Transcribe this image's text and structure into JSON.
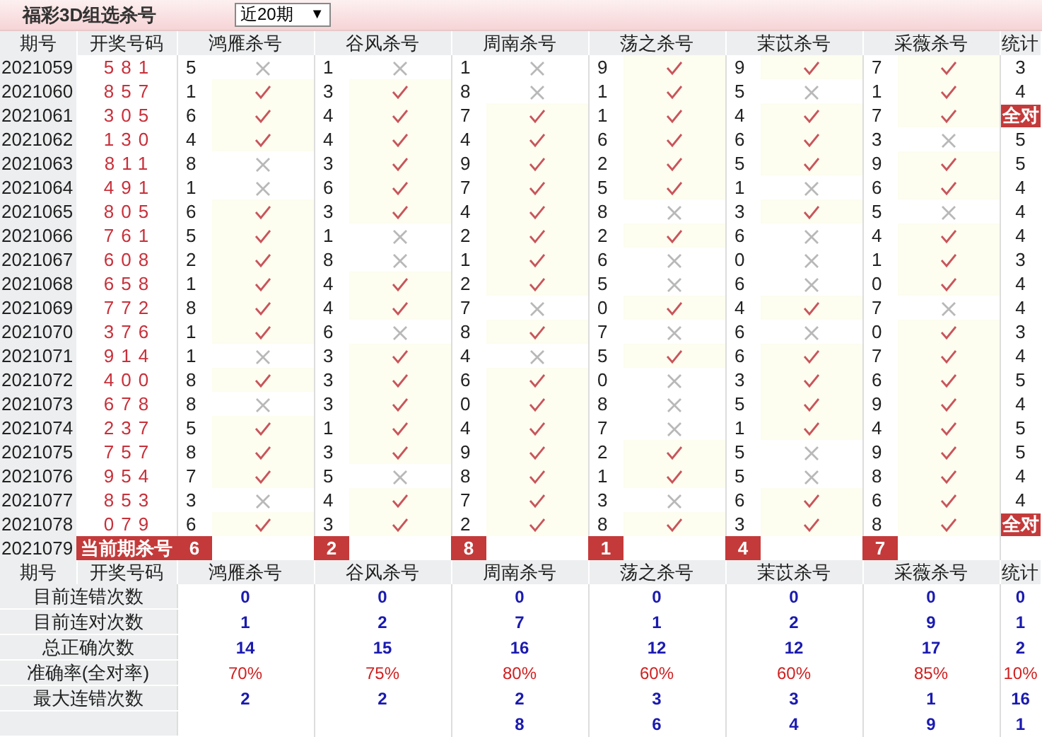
{
  "title": "福彩3D组选杀号",
  "range_select": {
    "value": "近20期",
    "arrow": "▼"
  },
  "columns": [
    "期号",
    "开奖号码",
    "鸿雁杀号",
    "谷风杀号",
    "周南杀号",
    "荡之杀号",
    "茉苡杀号",
    "采薇杀号",
    "统计"
  ],
  "rows": [
    {
      "period": "2021059",
      "draw": "581",
      "kills": [
        {
          "number": "5",
          "hit": false
        },
        {
          "number": "1",
          "hit": false
        },
        {
          "number": "1",
          "hit": false
        },
        {
          "number": "9",
          "hit": true
        },
        {
          "number": "9",
          "hit": true
        },
        {
          "number": "7",
          "hit": true
        }
      ],
      "stat": "3",
      "all_correct": false
    },
    {
      "period": "2021060",
      "draw": "857",
      "kills": [
        {
          "number": "1",
          "hit": true
        },
        {
          "number": "3",
          "hit": true
        },
        {
          "number": "8",
          "hit": false
        },
        {
          "number": "1",
          "hit": true
        },
        {
          "number": "5",
          "hit": false
        },
        {
          "number": "1",
          "hit": true
        }
      ],
      "stat": "4",
      "all_correct": false
    },
    {
      "period": "2021061",
      "draw": "305",
      "kills": [
        {
          "number": "6",
          "hit": true
        },
        {
          "number": "4",
          "hit": true
        },
        {
          "number": "7",
          "hit": true
        },
        {
          "number": "1",
          "hit": true
        },
        {
          "number": "4",
          "hit": true
        },
        {
          "number": "7",
          "hit": true
        }
      ],
      "stat": "全对",
      "all_correct": true
    },
    {
      "period": "2021062",
      "draw": "130",
      "kills": [
        {
          "number": "4",
          "hit": true
        },
        {
          "number": "4",
          "hit": true
        },
        {
          "number": "4",
          "hit": true
        },
        {
          "number": "6",
          "hit": true
        },
        {
          "number": "6",
          "hit": true
        },
        {
          "number": "3",
          "hit": false
        }
      ],
      "stat": "5",
      "all_correct": false
    },
    {
      "period": "2021063",
      "draw": "811",
      "kills": [
        {
          "number": "8",
          "hit": false
        },
        {
          "number": "3",
          "hit": true
        },
        {
          "number": "9",
          "hit": true
        },
        {
          "number": "2",
          "hit": true
        },
        {
          "number": "5",
          "hit": true
        },
        {
          "number": "9",
          "hit": true
        }
      ],
      "stat": "5",
      "all_correct": false
    },
    {
      "period": "2021064",
      "draw": "491",
      "kills": [
        {
          "number": "1",
          "hit": false
        },
        {
          "number": "6",
          "hit": true
        },
        {
          "number": "7",
          "hit": true
        },
        {
          "number": "5",
          "hit": true
        },
        {
          "number": "1",
          "hit": false
        },
        {
          "number": "6",
          "hit": true
        }
      ],
      "stat": "4",
      "all_correct": false
    },
    {
      "period": "2021065",
      "draw": "805",
      "kills": [
        {
          "number": "6",
          "hit": true
        },
        {
          "number": "3",
          "hit": true
        },
        {
          "number": "4",
          "hit": true
        },
        {
          "number": "8",
          "hit": false
        },
        {
          "number": "3",
          "hit": true
        },
        {
          "number": "5",
          "hit": false
        }
      ],
      "stat": "4",
      "all_correct": false
    },
    {
      "period": "2021066",
      "draw": "761",
      "kills": [
        {
          "number": "5",
          "hit": true
        },
        {
          "number": "1",
          "hit": false
        },
        {
          "number": "2",
          "hit": true
        },
        {
          "number": "2",
          "hit": true
        },
        {
          "number": "6",
          "hit": false
        },
        {
          "number": "4",
          "hit": true
        }
      ],
      "stat": "4",
      "all_correct": false
    },
    {
      "period": "2021067",
      "draw": "608",
      "kills": [
        {
          "number": "2",
          "hit": true
        },
        {
          "number": "8",
          "hit": false
        },
        {
          "number": "1",
          "hit": true
        },
        {
          "number": "6",
          "hit": false
        },
        {
          "number": "0",
          "hit": false
        },
        {
          "number": "1",
          "hit": true
        }
      ],
      "stat": "3",
      "all_correct": false
    },
    {
      "period": "2021068",
      "draw": "658",
      "kills": [
        {
          "number": "1",
          "hit": true
        },
        {
          "number": "4",
          "hit": true
        },
        {
          "number": "2",
          "hit": true
        },
        {
          "number": "5",
          "hit": false
        },
        {
          "number": "6",
          "hit": false
        },
        {
          "number": "0",
          "hit": true
        }
      ],
      "stat": "4",
      "all_correct": false
    },
    {
      "period": "2021069",
      "draw": "772",
      "kills": [
        {
          "number": "8",
          "hit": true
        },
        {
          "number": "4",
          "hit": true
        },
        {
          "number": "7",
          "hit": false
        },
        {
          "number": "0",
          "hit": true
        },
        {
          "number": "4",
          "hit": true
        },
        {
          "number": "7",
          "hit": false
        }
      ],
      "stat": "4",
      "all_correct": false
    },
    {
      "period": "2021070",
      "draw": "376",
      "kills": [
        {
          "number": "1",
          "hit": true
        },
        {
          "number": "6",
          "hit": false
        },
        {
          "number": "8",
          "hit": true
        },
        {
          "number": "7",
          "hit": false
        },
        {
          "number": "6",
          "hit": false
        },
        {
          "number": "0",
          "hit": true
        }
      ],
      "stat": "3",
      "all_correct": false
    },
    {
      "period": "2021071",
      "draw": "914",
      "kills": [
        {
          "number": "1",
          "hit": false
        },
        {
          "number": "3",
          "hit": true
        },
        {
          "number": "4",
          "hit": false
        },
        {
          "number": "5",
          "hit": true
        },
        {
          "number": "6",
          "hit": true
        },
        {
          "number": "7",
          "hit": true
        }
      ],
      "stat": "4",
      "all_correct": false
    },
    {
      "period": "2021072",
      "draw": "400",
      "kills": [
        {
          "number": "8",
          "hit": true
        },
        {
          "number": "3",
          "hit": true
        },
        {
          "number": "6",
          "hit": true
        },
        {
          "number": "0",
          "hit": false
        },
        {
          "number": "3",
          "hit": true
        },
        {
          "number": "6",
          "hit": true
        }
      ],
      "stat": "5",
      "all_correct": false
    },
    {
      "period": "2021073",
      "draw": "678",
      "kills": [
        {
          "number": "8",
          "hit": false
        },
        {
          "number": "3",
          "hit": true
        },
        {
          "number": "0",
          "hit": true
        },
        {
          "number": "8",
          "hit": false
        },
        {
          "number": "5",
          "hit": true
        },
        {
          "number": "9",
          "hit": true
        }
      ],
      "stat": "4",
      "all_correct": false
    },
    {
      "period": "2021074",
      "draw": "237",
      "kills": [
        {
          "number": "5",
          "hit": true
        },
        {
          "number": "1",
          "hit": true
        },
        {
          "number": "4",
          "hit": true
        },
        {
          "number": "7",
          "hit": false
        },
        {
          "number": "1",
          "hit": true
        },
        {
          "number": "4",
          "hit": true
        }
      ],
      "stat": "5",
      "all_correct": false
    },
    {
      "period": "2021075",
      "draw": "757",
      "kills": [
        {
          "number": "8",
          "hit": true
        },
        {
          "number": "3",
          "hit": true
        },
        {
          "number": "9",
          "hit": true
        },
        {
          "number": "2",
          "hit": true
        },
        {
          "number": "5",
          "hit": false
        },
        {
          "number": "9",
          "hit": true
        }
      ],
      "stat": "5",
      "all_correct": false
    },
    {
      "period": "2021076",
      "draw": "954",
      "kills": [
        {
          "number": "7",
          "hit": true
        },
        {
          "number": "5",
          "hit": false
        },
        {
          "number": "8",
          "hit": true
        },
        {
          "number": "1",
          "hit": true
        },
        {
          "number": "5",
          "hit": false
        },
        {
          "number": "8",
          "hit": true
        }
      ],
      "stat": "4",
      "all_correct": false
    },
    {
      "period": "2021077",
      "draw": "853",
      "kills": [
        {
          "number": "3",
          "hit": false
        },
        {
          "number": "4",
          "hit": true
        },
        {
          "number": "7",
          "hit": true
        },
        {
          "number": "3",
          "hit": false
        },
        {
          "number": "6",
          "hit": true
        },
        {
          "number": "6",
          "hit": true
        }
      ],
      "stat": "4",
      "all_correct": false
    },
    {
      "period": "2021078",
      "draw": "079",
      "kills": [
        {
          "number": "6",
          "hit": true
        },
        {
          "number": "3",
          "hit": true
        },
        {
          "number": "2",
          "hit": true
        },
        {
          "number": "8",
          "hit": true
        },
        {
          "number": "3",
          "hit": true
        },
        {
          "number": "8",
          "hit": true
        }
      ],
      "stat": "全对",
      "all_correct": true
    }
  ],
  "current": {
    "period": "2021079",
    "label": "当前期杀号",
    "kills": [
      "6",
      "2",
      "8",
      "1",
      "4",
      "7"
    ]
  },
  "summary": {
    "columns": [
      "期号",
      "开奖号码",
      "鸿雁杀号",
      "谷风杀号",
      "周南杀号",
      "荡之杀号",
      "茉苡杀号",
      "采薇杀号",
      "统计"
    ],
    "rows": [
      {
        "label": "目前连错次数",
        "kind": "count",
        "values": [
          "0",
          "0",
          "0",
          "0",
          "0",
          "0",
          "0"
        ]
      },
      {
        "label": "目前连对次数",
        "kind": "count",
        "values": [
          "1",
          "2",
          "7",
          "1",
          "2",
          "9",
          "1"
        ]
      },
      {
        "label": "总正确次数",
        "kind": "count",
        "values": [
          "14",
          "15",
          "16",
          "12",
          "12",
          "17",
          "2"
        ]
      },
      {
        "label": "准确率(全对率)",
        "kind": "rate",
        "values": [
          "70%",
          "75%",
          "80%",
          "60%",
          "60%",
          "85%",
          "10%"
        ]
      },
      {
        "label": "最大连错次数",
        "kind": "count",
        "values": [
          "2",
          "2",
          "2",
          "3",
          "3",
          "1",
          "16"
        ]
      },
      {
        "kind": "count",
        "values": [
          "8",
          "6",
          "4",
          "9",
          "1"
        ]
      }
    ]
  }
}
